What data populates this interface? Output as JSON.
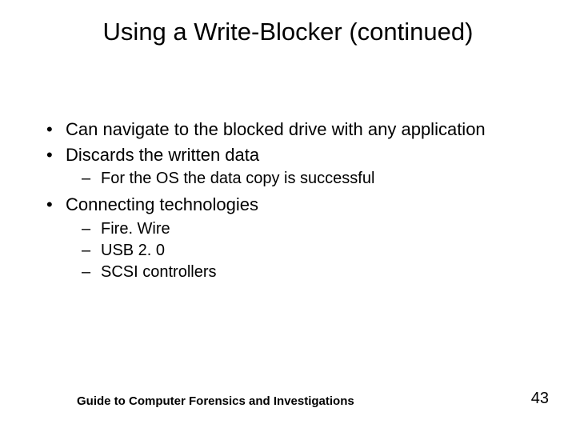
{
  "title": "Using a Write-Blocker (continued)",
  "bullets": {
    "b0": "Can navigate to the blocked drive with any application",
    "b1": "Discards the written data",
    "b1s": {
      "s0": "For the OS the data copy is successful"
    },
    "b2": "Connecting technologies",
    "b2s": {
      "s0": "Fire. Wire",
      "s1": "USB 2. 0",
      "s2": "SCSI controllers"
    }
  },
  "footer": "Guide to Computer Forensics and Investigations",
  "page": "43"
}
